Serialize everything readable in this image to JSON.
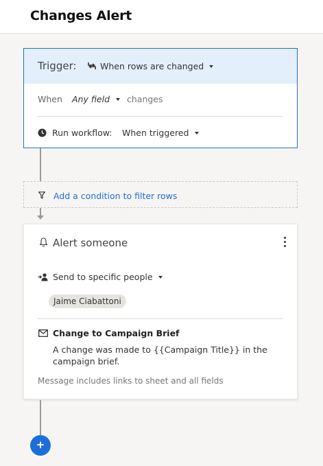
{
  "header": {
    "title": "Changes Alert"
  },
  "trigger": {
    "label": "Trigger:",
    "value": "When rows are changed",
    "when_label": "When",
    "field": "Any field",
    "changes_label": "changes",
    "run_label": "Run workflow:",
    "run_value": "When triggered"
  },
  "condition": {
    "link": "Add a condition to filter rows"
  },
  "alert": {
    "title": "Alert someone",
    "send_label": "Send to specific people",
    "recipient": "Jaime Ciabattoni",
    "subject": "Change to Campaign Brief",
    "message": "A change was made to {{Campaign Title}} in the campaign brief.",
    "note": "Message includes links to sheet and all fields"
  },
  "add_button": {
    "label": "+"
  },
  "colors": {
    "accent": "#1d6fd8",
    "trigger_bg": "#e3effb",
    "link": "#1f6fcc"
  }
}
